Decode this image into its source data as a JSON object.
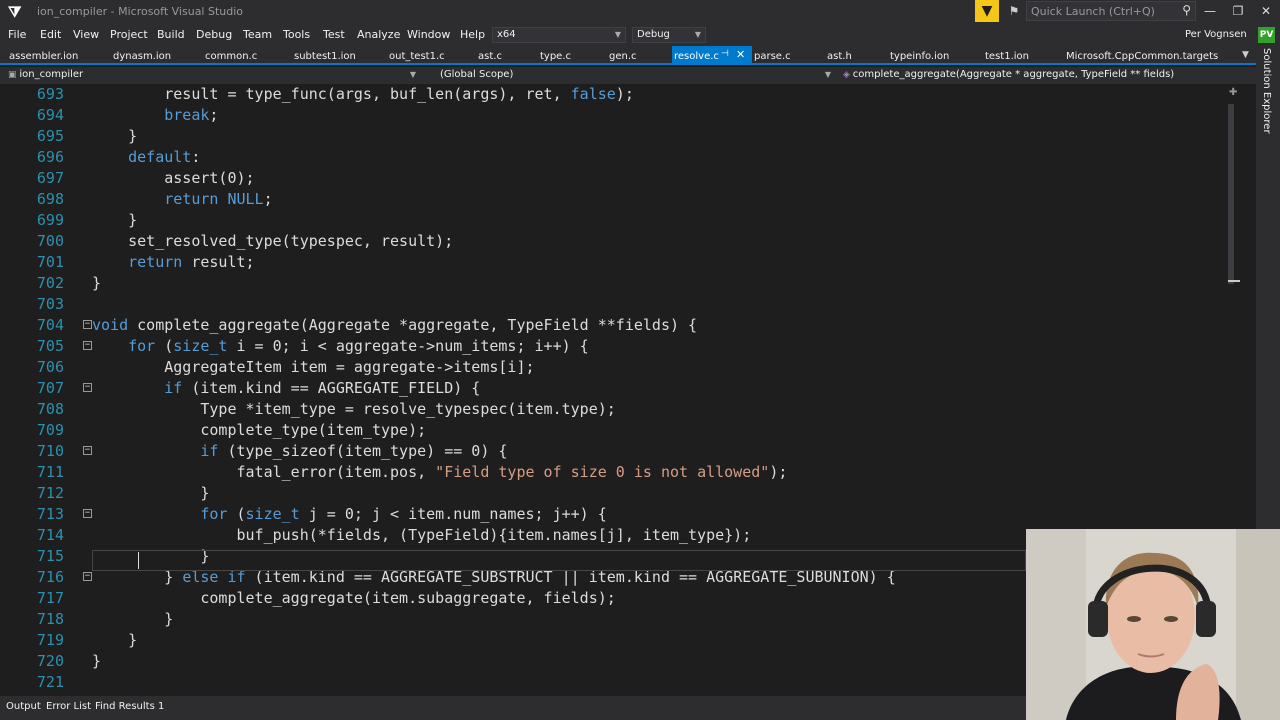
{
  "window": {
    "title": "ion_compiler - Microsoft Visual Studio",
    "quick_launch_placeholder": "Quick Launch (Ctrl+Q)"
  },
  "menu": [
    "File",
    "Edit",
    "View",
    "Project",
    "Build",
    "Debug",
    "Team",
    "Tools",
    "Test",
    "Analyze",
    "Window",
    "Help"
  ],
  "toolbar": {
    "platform": "x64",
    "configuration": "Debug",
    "user": "Per Vognsen",
    "avatar_initials": "PV"
  },
  "tabs": [
    {
      "label": "assembler.ion"
    },
    {
      "label": "dynasm.ion"
    },
    {
      "label": "common.c"
    },
    {
      "label": "subtest1.ion"
    },
    {
      "label": "out_test1.c"
    },
    {
      "label": "ast.c"
    },
    {
      "label": "type.c"
    },
    {
      "label": "gen.c"
    },
    {
      "label": "resolve.c",
      "active": true
    },
    {
      "label": "parse.c"
    },
    {
      "label": "ast.h"
    },
    {
      "label": "typeinfo.ion"
    },
    {
      "label": "test1.ion"
    },
    {
      "label": "Microsoft.CppCommon.targets"
    }
  ],
  "navbar": {
    "project": "ion_compiler",
    "scope": "(Global Scope)",
    "function": "complete_aggregate(Aggregate * aggregate, TypeField ** fields)"
  },
  "side_panel": {
    "label": "Solution Explorer"
  },
  "code": [
    {
      "n": "693",
      "text": "        result = type_func(args, buf_len(args), ret, false);"
    },
    {
      "n": "694",
      "text": "        break;"
    },
    {
      "n": "695",
      "text": "    }"
    },
    {
      "n": "696",
      "text": "    default:"
    },
    {
      "n": "697",
      "text": "        assert(0);"
    },
    {
      "n": "698",
      "text": "        return NULL;"
    },
    {
      "n": "699",
      "text": "    }"
    },
    {
      "n": "700",
      "text": "    set_resolved_type(typespec, result);"
    },
    {
      "n": "701",
      "text": "    return result;"
    },
    {
      "n": "702",
      "text": "}"
    },
    {
      "n": "703",
      "text": ""
    },
    {
      "n": "704",
      "text": "void complete_aggregate(Aggregate *aggregate, TypeField **fields) {"
    },
    {
      "n": "705",
      "text": "    for (size_t i = 0; i < aggregate->num_items; i++) {"
    },
    {
      "n": "706",
      "text": "        AggregateItem item = aggregate->items[i];"
    },
    {
      "n": "707",
      "text": "        if (item.kind == AGGREGATE_FIELD) {"
    },
    {
      "n": "708",
      "text": "            Type *item_type = resolve_typespec(item.type);"
    },
    {
      "n": "709",
      "text": "            complete_type(item_type);"
    },
    {
      "n": "710",
      "text": "            if (type_sizeof(item_type) == 0) {"
    },
    {
      "n": "711",
      "text": "                fatal_error(item.pos, \"Field type of size 0 is not allowed\");"
    },
    {
      "n": "712",
      "text": "            }"
    },
    {
      "n": "713",
      "text": "            for (size_t j = 0; j < item.num_names; j++) {"
    },
    {
      "n": "714",
      "text": "                buf_push(*fields, (TypeField){item.names[j], item_type});"
    },
    {
      "n": "715",
      "text": "            }"
    },
    {
      "n": "716",
      "text": "        } else if (item.kind == AGGREGATE_SUBSTRUCT || item.kind == AGGREGATE_SUBUNION) {"
    },
    {
      "n": "717",
      "text": "            complete_aggregate(item.subaggregate, fields);"
    },
    {
      "n": "718",
      "text": "        }"
    },
    {
      "n": "719",
      "text": "    }"
    },
    {
      "n": "720",
      "text": "}"
    },
    {
      "n": "721",
      "text": ""
    }
  ],
  "bottom_tabs": [
    "Output",
    "Error List",
    "Find Results 1"
  ],
  "colors": {
    "accent": "#007acc",
    "keyword": "#569cd6",
    "string": "#d69d85",
    "line_number": "#2b91af",
    "change_bar": "#57a64a"
  }
}
